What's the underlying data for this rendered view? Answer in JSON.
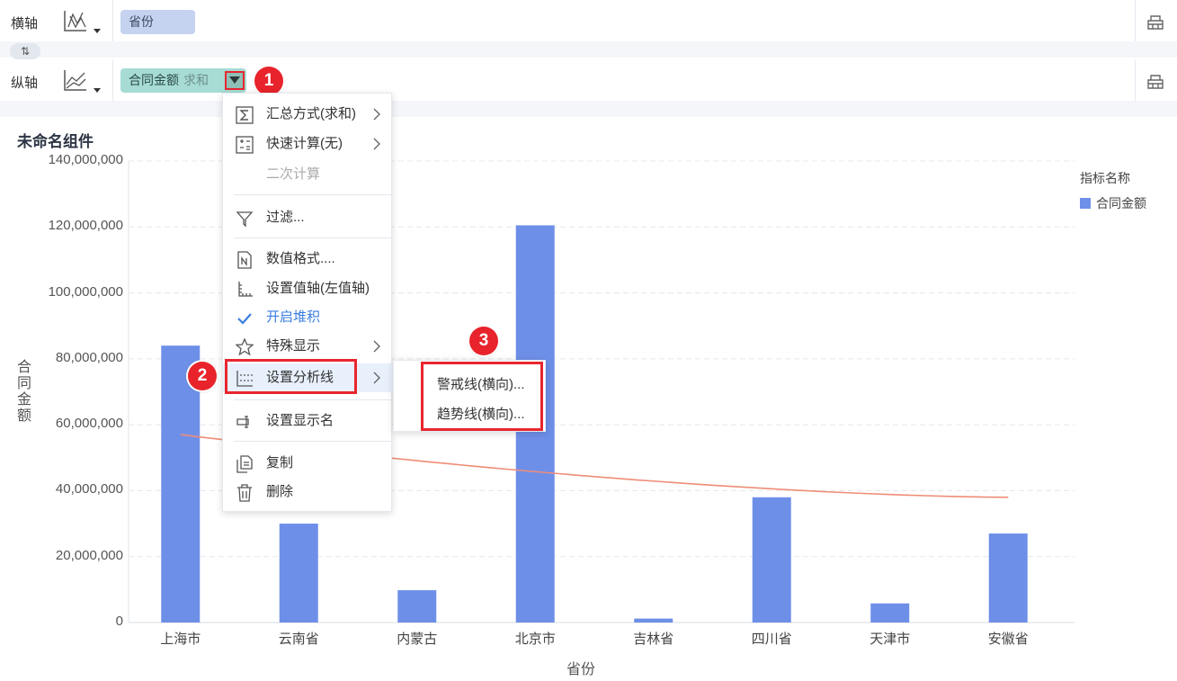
{
  "xaxis_row": {
    "label": "横轴",
    "field": "省份",
    "chart_icon": "bar-chart-dropdown-icon",
    "right_icon": "tray-icon"
  },
  "yaxis_row": {
    "label": "纵轴",
    "field": "合同金额",
    "agg": "求和",
    "chart_icon": "line-chart-dropdown-icon",
    "right_icon": "tray-icon"
  },
  "swap_label": "⇅",
  "badges": [
    "1",
    "2",
    "3"
  ],
  "widget_title": "未命名组件",
  "menu": {
    "items": [
      {
        "label": "汇总方式(求和)",
        "icon": "sigma-icon",
        "has_sub": true
      },
      {
        "label": "快速计算(无)",
        "icon": "calculator-icon",
        "has_sub": true
      },
      {
        "label": "二次计算",
        "icon": "",
        "has_sub": false,
        "disabled": true
      },
      {
        "label": "过滤...",
        "icon": "filter-icon",
        "has_sub": false
      },
      {
        "label": "数值格式....",
        "icon": "number-format-icon",
        "has_sub": false
      },
      {
        "label": "设置值轴(左值轴)",
        "icon": "value-axis-icon",
        "has_sub": false
      },
      {
        "label": "开启堆积",
        "icon": "check-icon",
        "has_sub": false,
        "active": true
      },
      {
        "label": "特殊显示",
        "icon": "star-icon",
        "has_sub": true
      },
      {
        "label": "设置分析线",
        "icon": "analysis-line-icon",
        "has_sub": true,
        "highlighted": true
      },
      {
        "label": "设置显示名",
        "icon": "rename-icon",
        "has_sub": false
      },
      {
        "label": "复制",
        "icon": "copy-icon",
        "has_sub": false
      },
      {
        "label": "删除",
        "icon": "trash-icon",
        "has_sub": false
      }
    ]
  },
  "submenu": {
    "items": [
      "警戒线(横向)...",
      "趋势线(横向)..."
    ]
  },
  "legend": {
    "title": "指标名称",
    "item": "合同金额"
  },
  "colors": {
    "bar": "#6e8fe8",
    "trend": "#ef8d78",
    "accent": "#3a7de0",
    "highlight": "#e8262f"
  },
  "chart_data": {
    "type": "bar",
    "categories": [
      "上海市",
      "云南省",
      "内蒙古",
      "北京市",
      "吉林省",
      "四川省",
      "天津市",
      "安徽省"
    ],
    "series": [
      {
        "name": "合同金额",
        "values": [
          84000000,
          30000000,
          9800000,
          120500000,
          1200000,
          38000000,
          5800000,
          27000000
        ]
      }
    ],
    "trend_line": {
      "start": 57000000,
      "end": 38000000
    },
    "xlabel": "省份",
    "ylabel": "合同金额",
    "ylim": [
      0,
      140000000
    ],
    "yticks": [
      "0",
      "20,000,000",
      "40,000,000",
      "60,000,000",
      "80,000,000",
      "100,000,000",
      "120,000,000",
      "140,000,000"
    ],
    "grid": true,
    "legend": "top-right"
  }
}
